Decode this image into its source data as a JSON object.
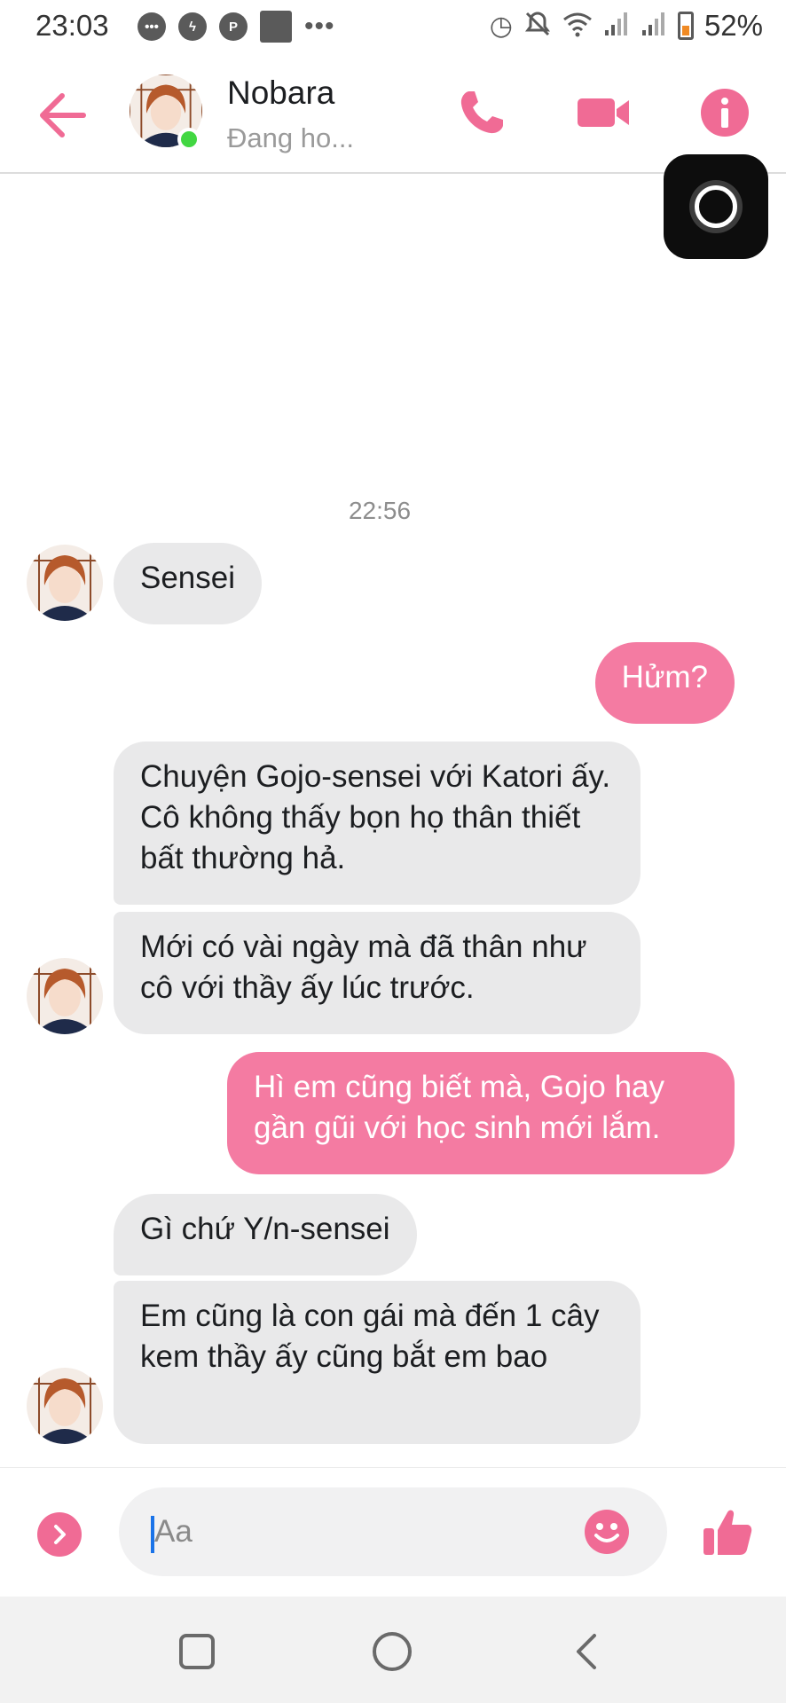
{
  "status_bar": {
    "time": "23:03",
    "battery": "52%",
    "left_icons": [
      "messages-icon",
      "messenger-icon",
      "pinterest-icon",
      "app-icon",
      "more-dots-icon"
    ],
    "right_icons": [
      "alarm-icon",
      "mute-icon",
      "wifi-icon",
      "signal-icon",
      "signal-icon",
      "battery-icon"
    ]
  },
  "header": {
    "name": "Nobara",
    "status": "Đang ho..."
  },
  "chat": {
    "timestamp": "22:56",
    "messages": [
      {
        "side": "in",
        "text": "Sensei"
      },
      {
        "side": "out",
        "text": "Hửm?"
      },
      {
        "side": "in",
        "text": "Chuyện Gojo-sensei với Katori ấy. Cô không thấy bọn họ thân thiết bất thường hả."
      },
      {
        "side": "in",
        "text": "Mới có vài ngày mà đã thân như cô với thầy ấy lúc trước."
      },
      {
        "side": "out",
        "text": "Hì em cũng biết mà, Gojo hay gần gũi với học sinh mới lắm."
      },
      {
        "side": "in",
        "text": "Gì chứ Y/n-sensei"
      },
      {
        "side": "in",
        "text": "Em cũng là con gái mà đến 1 cây kem thầy ấy cũng bắt em bao"
      }
    ]
  },
  "composer": {
    "placeholder": "Aa",
    "value": ""
  },
  "colors": {
    "accent": "#f06b95",
    "outgoing_bubble": "#f47ba2",
    "incoming_bubble": "#e9e9ea",
    "online": "#42d742"
  }
}
